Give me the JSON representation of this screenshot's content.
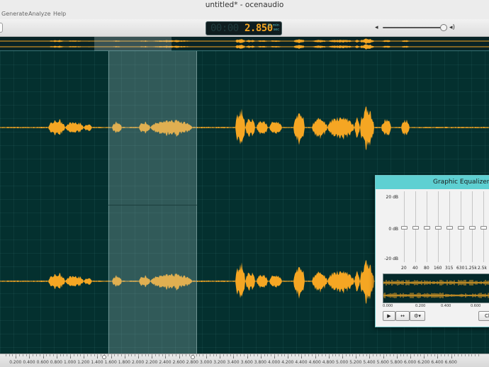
{
  "window": {
    "title": "untitled* - ocenaudio"
  },
  "menu": {
    "items": [
      "Generate",
      "Analyze",
      "Help"
    ]
  },
  "toolbar": {
    "time_display": {
      "ghost": "00:00",
      "value": "2.850",
      "unit_top": "hr min",
      "unit_bottom": "sec"
    },
    "volume": {
      "low_icon": "speaker-low-icon",
      "high_icon": "speaker-high-icon",
      "level": 0.93
    }
  },
  "timeline": {
    "labels": [
      "0.200",
      "0.400",
      "0.600",
      "0.800",
      "1.000",
      "1.200",
      "1.400",
      "1.600",
      "1.800",
      "2.000",
      "2.200",
      "2.400",
      "2.600",
      "2.800",
      "3.000",
      "3.200",
      "3.400",
      "3.600",
      "3.800",
      "4.000",
      "4.200",
      "4.400",
      "4.600",
      "4.800",
      "5.000",
      "5.200",
      "5.400",
      "5.600",
      "5.800",
      "6.000",
      "6.200",
      "6.400",
      "6.600"
    ],
    "selection": {
      "start": 1.5,
      "end": 2.8
    }
  },
  "equalizer": {
    "title": "Graphic Equalizer",
    "db_labels": [
      "20 dB",
      "0 dB",
      "-20 dB"
    ],
    "bands": [
      "20",
      "40",
      "80",
      "160",
      "315",
      "630",
      "1.25k",
      "2.5k"
    ],
    "gains_db": [
      0,
      0,
      0,
      0,
      0,
      0,
      0,
      0
    ],
    "preview_labels": [
      "0.000",
      "0.200",
      "0.400",
      "0.600"
    ],
    "buttons": {
      "play": "play-icon",
      "loop": "loop-icon",
      "settings": "gear-icon",
      "close_partial": "Cl"
    }
  },
  "colors": {
    "waveform": "#f5a623",
    "background": "#04302f",
    "accent": "#5ed0d2"
  }
}
